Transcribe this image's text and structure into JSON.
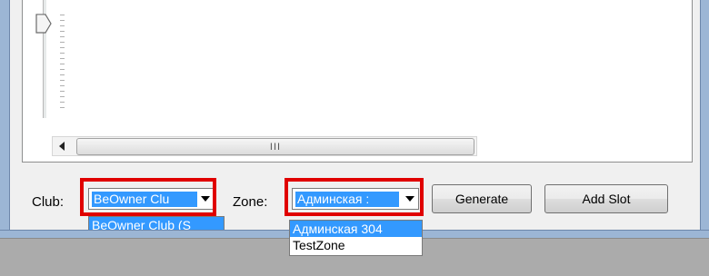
{
  "scrollbar": {
    "grip": "III"
  },
  "club": {
    "label": "Club:",
    "selected": "BeOwner Clu",
    "options": [
      "BeOwner Club (S"
    ]
  },
  "zone": {
    "label": "Zone:",
    "selected": "Админская :",
    "options": [
      "Админская 304",
      "TestZone"
    ]
  },
  "buttons": {
    "generate": "Generate",
    "add_slot": "Add Slot"
  },
  "colors": {
    "highlight": "#e00000",
    "selection": "#3399ff",
    "frame": "#9cb6d5"
  }
}
